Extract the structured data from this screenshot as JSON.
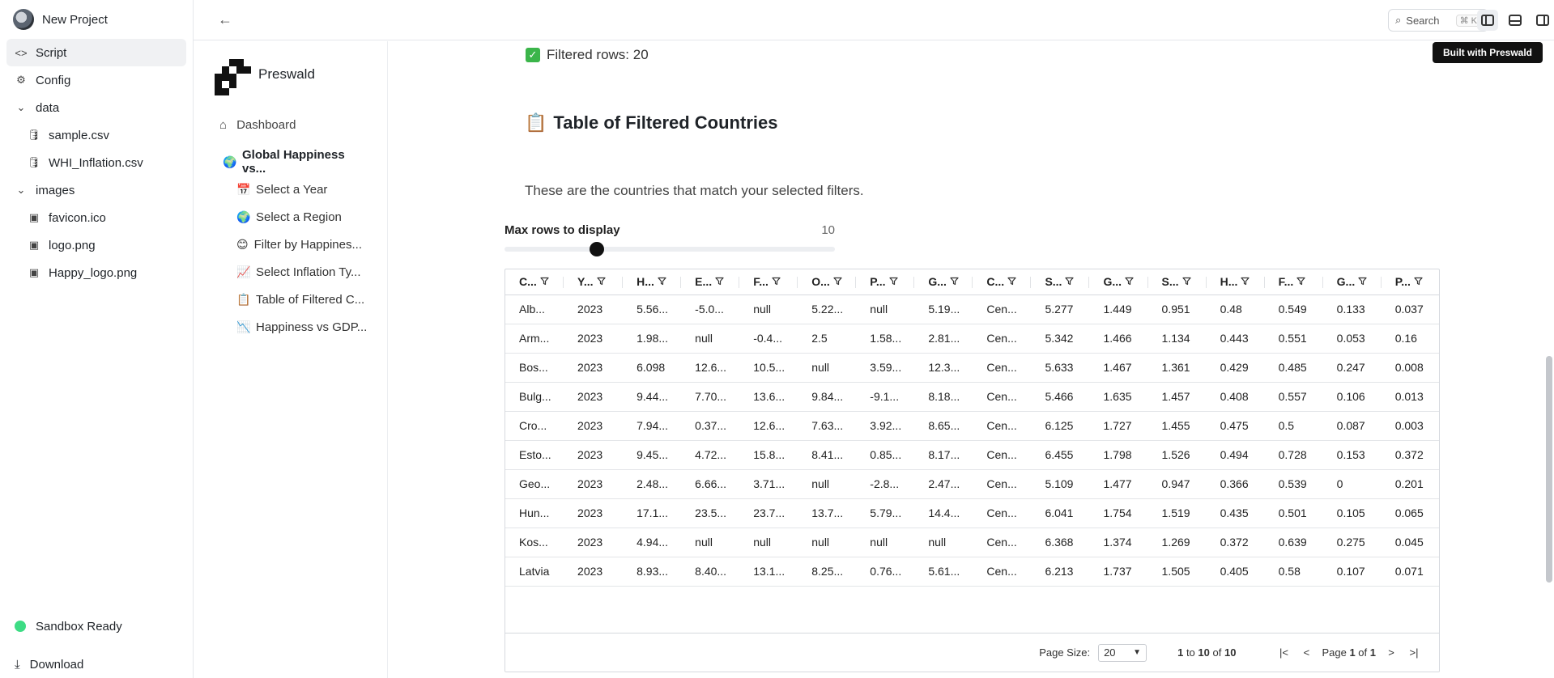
{
  "project": {
    "name": "New Project"
  },
  "sidebar": {
    "items": [
      {
        "label": "Script",
        "icon": "code-icon"
      },
      {
        "label": "Config",
        "icon": "gear-icon"
      },
      {
        "label": "data",
        "icon": "chevron-down-icon"
      },
      {
        "label": "sample.csv",
        "icon": "database-icon"
      },
      {
        "label": "WHI_Inflation.csv",
        "icon": "database-icon"
      },
      {
        "label": "images",
        "icon": "chevron-down-icon"
      },
      {
        "label": "favicon.ico",
        "icon": "image-icon"
      },
      {
        "label": "logo.png",
        "icon": "image-icon"
      },
      {
        "label": "Happy_logo.png",
        "icon": "image-icon"
      }
    ],
    "status": "Sandbox Ready",
    "download": "Download"
  },
  "topbar": {
    "search_label": "Search",
    "search_shortcut": "⌘ K"
  },
  "badge": "Built with Preswald",
  "nav": {
    "brand": "Preswald",
    "dashboard": "Dashboard",
    "section": "Global Happiness vs...",
    "subitems": [
      {
        "emoji": "📅",
        "label": "Select a Year"
      },
      {
        "emoji": "🌍",
        "label": "Select a Region"
      },
      {
        "emoji": "😊",
        "label": "Filter by Happines..."
      },
      {
        "emoji": "📈",
        "label": "Select Inflation Ty..."
      },
      {
        "emoji": "📋",
        "label": "Table of Filtered C..."
      },
      {
        "emoji": "📉",
        "label": "Happiness vs GDP..."
      }
    ]
  },
  "main": {
    "filtered_text": "Filtered rows: 20",
    "title": "Table of Filtered Countries",
    "title_emoji": "📋",
    "description": "These are the countries that match your selected filters.",
    "slider": {
      "label": "Max rows to display",
      "value": "10",
      "fraction": 0.28
    }
  },
  "table": {
    "columns": [
      "C...",
      "Y...",
      "H...",
      "E...",
      "F...",
      "O...",
      "P...",
      "G...",
      "C...",
      "S...",
      "G...",
      "S...",
      "H...",
      "F...",
      "G...",
      "P..."
    ],
    "rows": [
      [
        "Alb...",
        "2023",
        "5.56...",
        "-5.0...",
        "null",
        "5.22...",
        "null",
        "5.19...",
        "Cen...",
        "5.277",
        "1.449",
        "0.951",
        "0.48",
        "0.549",
        "0.133",
        "0.037"
      ],
      [
        "Arm...",
        "2023",
        "1.98...",
        "null",
        "-0.4...",
        "2.5",
        "1.58...",
        "2.81...",
        "Cen...",
        "5.342",
        "1.466",
        "1.134",
        "0.443",
        "0.551",
        "0.053",
        "0.16"
      ],
      [
        "Bos...",
        "2023",
        "6.098",
        "12.6...",
        "10.5...",
        "null",
        "3.59...",
        "12.3...",
        "Cen...",
        "5.633",
        "1.467",
        "1.361",
        "0.429",
        "0.485",
        "0.247",
        "0.008"
      ],
      [
        "Bulg...",
        "2023",
        "9.44...",
        "7.70...",
        "13.6...",
        "9.84...",
        "-9.1...",
        "8.18...",
        "Cen...",
        "5.466",
        "1.635",
        "1.457",
        "0.408",
        "0.557",
        "0.106",
        "0.013"
      ],
      [
        "Cro...",
        "2023",
        "7.94...",
        "0.37...",
        "12.6...",
        "7.63...",
        "3.92...",
        "8.65...",
        "Cen...",
        "6.125",
        "1.727",
        "1.455",
        "0.475",
        "0.5",
        "0.087",
        "0.003"
      ],
      [
        "Esto...",
        "2023",
        "9.45...",
        "4.72...",
        "15.8...",
        "8.41...",
        "0.85...",
        "8.17...",
        "Cen...",
        "6.455",
        "1.798",
        "1.526",
        "0.494",
        "0.728",
        "0.153",
        "0.372"
      ],
      [
        "Geo...",
        "2023",
        "2.48...",
        "6.66...",
        "3.71...",
        "null",
        "-2.8...",
        "2.47...",
        "Cen...",
        "5.109",
        "1.477",
        "0.947",
        "0.366",
        "0.539",
        "0",
        "0.201"
      ],
      [
        "Hun...",
        "2023",
        "17.1...",
        "23.5...",
        "23.7...",
        "13.7...",
        "5.79...",
        "14.4...",
        "Cen...",
        "6.041",
        "1.754",
        "1.519",
        "0.435",
        "0.501",
        "0.105",
        "0.065"
      ],
      [
        "Kos...",
        "2023",
        "4.94...",
        "null",
        "null",
        "null",
        "null",
        "null",
        "Cen...",
        "6.368",
        "1.374",
        "1.269",
        "0.372",
        "0.639",
        "0.275",
        "0.045"
      ],
      [
        "Latvia",
        "2023",
        "8.93...",
        "8.40...",
        "13.1...",
        "8.25...",
        "0.76...",
        "5.61...",
        "Cen...",
        "6.213",
        "1.737",
        "1.505",
        "0.405",
        "0.58",
        "0.107",
        "0.071"
      ]
    ],
    "pager": {
      "page_size_label": "Page Size:",
      "page_size": "20",
      "from": "1",
      "to_word": "to",
      "to": "10",
      "of_word": "of",
      "total": "10",
      "page_word": "Page",
      "page": "1",
      "page_of": "of",
      "page_total": "1"
    }
  }
}
